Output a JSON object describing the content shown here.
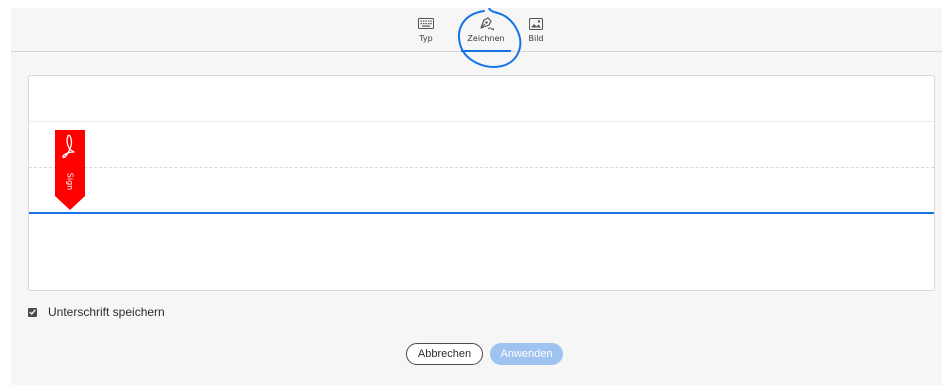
{
  "tabs": {
    "typ": {
      "label": "Typ",
      "icon": "keyboard-icon"
    },
    "draw": {
      "label": "Zeichnen",
      "icon": "pen-icon",
      "active": true
    },
    "bild": {
      "label": "Bild",
      "icon": "image-icon"
    }
  },
  "signature_tag": {
    "text": "Sign",
    "icon": "acrobat-icon",
    "color": "#ff0000"
  },
  "save_option": {
    "label": "Unterschrift speichern",
    "checked": true
  },
  "buttons": {
    "cancel": "Abbrechen",
    "apply": "Anwenden"
  },
  "colors": {
    "accent": "#1473e6",
    "annotation": "#1473e6",
    "apply_disabled": "#9fc3f0",
    "tag": "#ff0000"
  }
}
